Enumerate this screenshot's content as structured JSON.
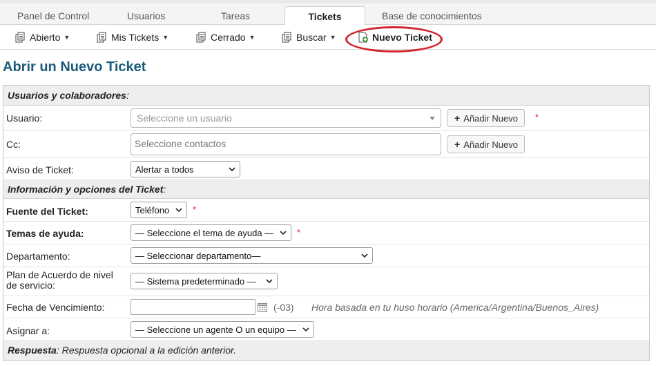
{
  "top_tabs": [
    "Panel de Control",
    "Usuarios",
    "Tareas",
    "Tickets",
    "Base de conocimientos"
  ],
  "sub_nav": {
    "items": [
      "Abierto",
      "Mis Tickets",
      "Cerrado",
      "Buscar",
      "Nuevo Ticket"
    ]
  },
  "page_title": "Abrir un Nuevo Ticket",
  "sections": {
    "users": "Usuarios y colaboradores",
    "info": "Información y opciones del Ticket",
    "response_bold": "Respuesta",
    "response_rest": ": Respuesta opcional a la edición anterior."
  },
  "fields": {
    "usuario_label": "Usuario:",
    "usuario_placeholder": "Seleccione un usuario",
    "cc_label": "Cc:",
    "cc_placeholder": "Seleccione contactos",
    "add_new": "Añadir Nuevo",
    "aviso_label": "Aviso de Ticket:",
    "aviso_value": "Alertar a todos",
    "fuente_label": "Fuente del Ticket:",
    "fuente_value": "Teléfono",
    "temas_label": "Temas de ayuda:",
    "temas_value": "— Seleccione el tema de ayuda —",
    "depto_label": "Departamento:",
    "depto_value": "— Seleccionar departamento—",
    "sla_label_1": "Plan de Acuerdo de nivel",
    "sla_label_2": "de servicio:",
    "sla_value": "— Sistema predeterminado —",
    "fecha_label": "Fecha de Vencimiento:",
    "tz_offset": "(-03)",
    "tz_hint": "Hora basada en tu huso horario (America/Argentina/Buenos_Aires)",
    "asignar_label": "Asignar a:",
    "asignar_value": "— Seleccione un agente O un equipo —",
    "required_mark": "*",
    "colon": ":"
  },
  "colors": {
    "title": "#1d5b7a",
    "highlight": "#d2232a",
    "required": "#dd2222"
  }
}
